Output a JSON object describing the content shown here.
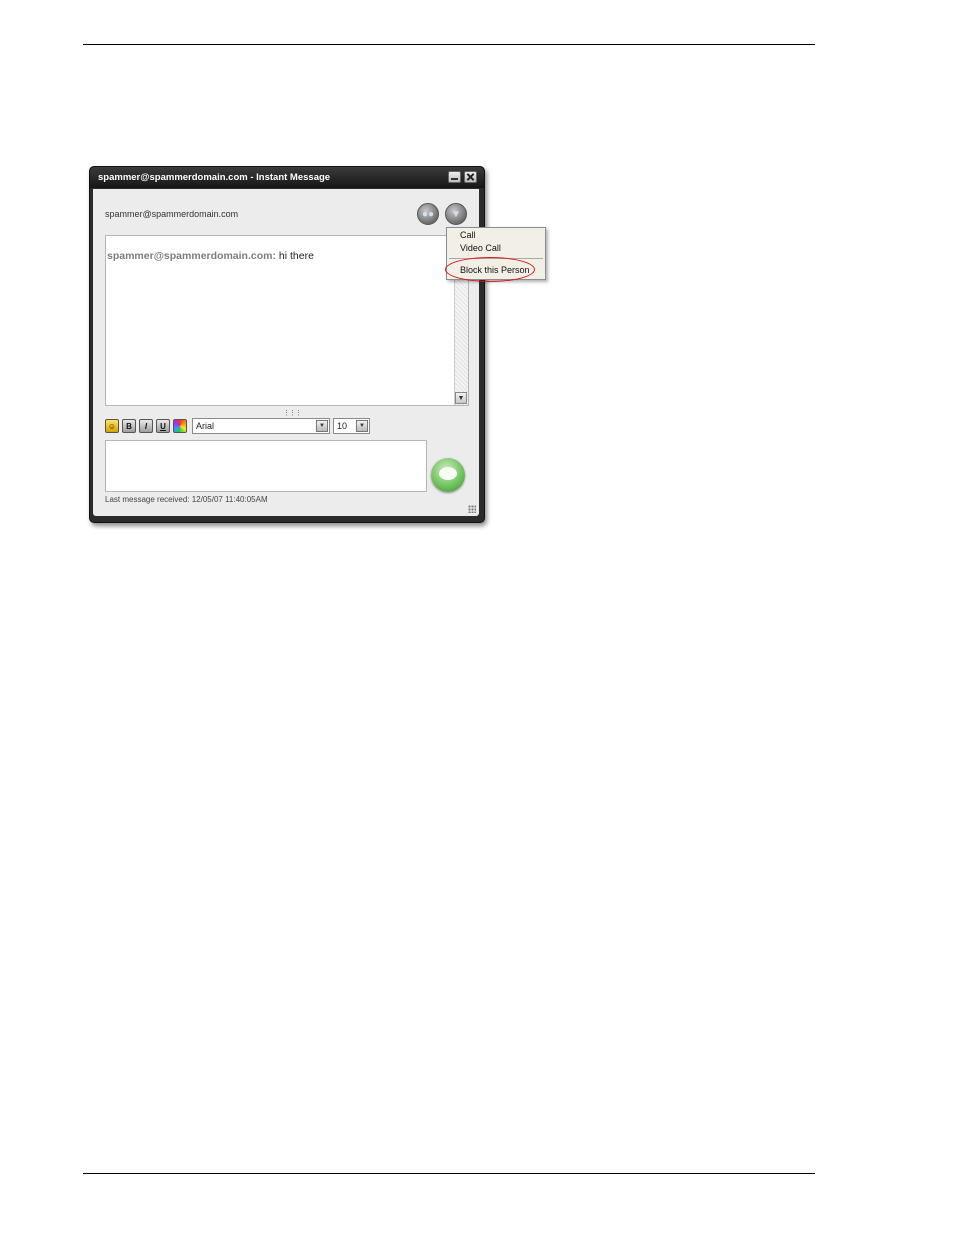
{
  "window": {
    "title": "spammer@spammerdomain.com - Instant Message",
    "contact": "spammer@spammerdomain.com"
  },
  "conversation": {
    "messages": [
      {
        "sender": "spammer@spammerdomain.com:",
        "text": "hi there"
      }
    ]
  },
  "format_toolbar": {
    "emoji_icon": "smiley-icon",
    "bold_label": "B",
    "italic_label": "I",
    "underline_label": "U",
    "font": "Arial",
    "font_size": "10"
  },
  "status": {
    "text": "Last message received: 12/05/07 11:40:05AM"
  },
  "context_menu": {
    "items": [
      {
        "label": "Call"
      },
      {
        "label": "Video Call"
      },
      {
        "label": "Block this Person"
      }
    ]
  },
  "colors": {
    "highlight": "#d31d1d",
    "send_button": "#6bbf59",
    "title_bar": "#1e1e1e"
  }
}
